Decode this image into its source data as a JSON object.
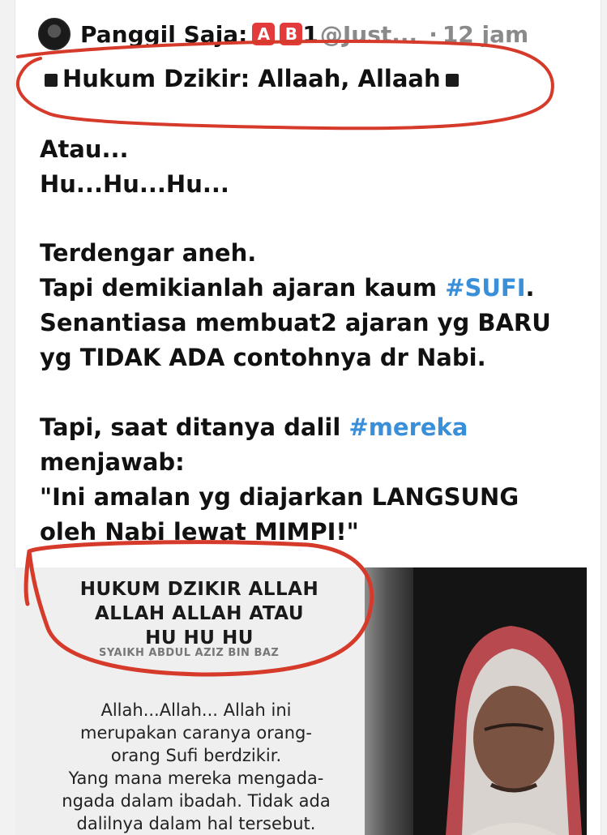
{
  "tweet": {
    "display_name": "Panggil Saja:",
    "badge_1": "🅰",
    "badge_2": "🅱",
    "badge_suffix": "1",
    "handle": "@Just...",
    "separator": "·",
    "timestamp": "12 jam",
    "title": "Hukum Dzikir: Allaah, Allaah",
    "lines": {
      "l1": "Atau...",
      "l2": "Hu...Hu...Hu...",
      "l3": "Terdengar aneh.",
      "l4_pre": "Tapi demikianlah ajaran kaum ",
      "l4_tag": "#SUFI",
      "l4_post": ".",
      "l5": "Senantiasa membuat2 ajaran yg BARU",
      "l6": "yg TIDAK ADA contohnya dr Nabi.",
      "l7_pre": "Tapi, saat ditanya dalil ",
      "l7_tag": "#mereka",
      "l8": "menjawab:",
      "l9": "\"Ini amalan yg diajarkan LANGSUNG",
      "l10": "oleh Nabi lewat MIMPI!\""
    }
  },
  "media": {
    "title_line1": "HUKUM DZIKIR ALLAH",
    "title_line2": "ALLAH ALLAH ATAU",
    "title_line3": "HU HU HU",
    "subtitle": "SYAIKH ABDUL AZIZ BIN BAZ",
    "body": [
      "Allah...Allah... Allah ini",
      "merupakan caranya orang-",
      "orang Sufi berdzikir.",
      "Yang mana mereka mengada-",
      "ngada dalam ibadah. Tidak ada",
      "dalilnya dalam hal tersebut."
    ]
  },
  "colors": {
    "hashtag": "#3a8fd9",
    "annotation": "#d63a2a",
    "badge": "#e33b3b"
  }
}
